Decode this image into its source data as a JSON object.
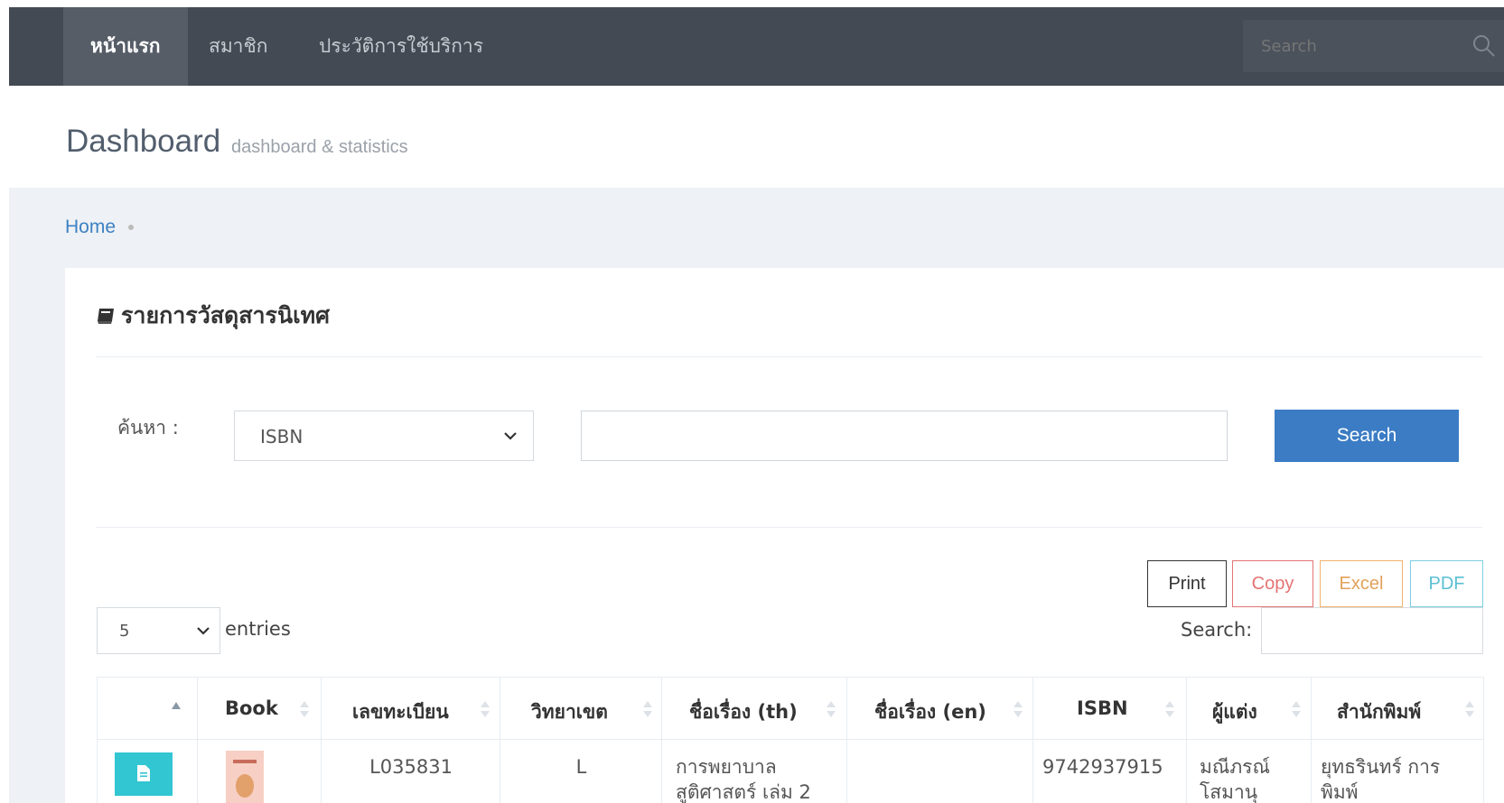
{
  "nav": {
    "items": [
      {
        "label": "หน้าแรก",
        "active": true
      },
      {
        "label": "สมาชิก",
        "active": false
      },
      {
        "label": "ประวัติการใช้บริการ",
        "active": false
      }
    ],
    "search_placeholder": "Search"
  },
  "page": {
    "title": "Dashboard",
    "subtitle": "dashboard & statistics"
  },
  "breadcrumb": {
    "home": "Home"
  },
  "panel": {
    "title": "รายการวัสดุสารนิเทศ",
    "search_label": "ค้นหา :",
    "search_field_value": "ISBN",
    "search_text": "",
    "search_button": "Search"
  },
  "exports": {
    "print": "Print",
    "copy": "Copy",
    "excel": "Excel",
    "pdf": "PDF"
  },
  "table_controls": {
    "entries_value": "5",
    "entries_label": "entries",
    "search_label": "Search:"
  },
  "table": {
    "headers": [
      "",
      "Book",
      "เลขทะเบียน",
      "วิทยาเขต",
      "ชื่อเรื่อง (th)",
      "ชื่อเรื่อง (en)",
      "ISBN",
      "ผู้แต่ง",
      "สำนักพิมพ์"
    ],
    "rows": [
      {
        "reg_no": "L035831",
        "campus": "L",
        "title_th": "การพยาบาล สูติศาสตร์ เล่ม 2",
        "title_en": "",
        "isbn": "9742937915",
        "author": "มณีภรณ์ โสมานุ",
        "publisher": "ยุทธรินทร์ การพิมพ์"
      }
    ]
  },
  "colors": {
    "topbar": "#434a54",
    "accent": "#3b7cc4",
    "doc_button": "#32c5d2"
  }
}
